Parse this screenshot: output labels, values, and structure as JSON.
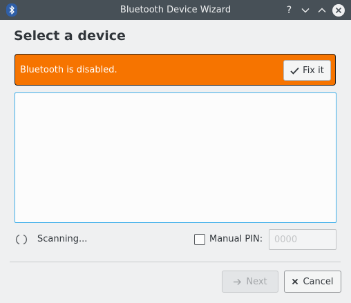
{
  "window": {
    "title": "Bluetooth Device Wizard",
    "icons": {
      "app": "bluetooth-icon",
      "help": "help-icon",
      "minimize": "chevron-down-icon",
      "maximize": "chevron-up-icon",
      "close": "close-icon"
    }
  },
  "page": {
    "heading": "Select a device"
  },
  "banner": {
    "message": "Bluetooth is disabled.",
    "action_label": "Fix it",
    "action_icon": "check-icon",
    "color": "#f67400"
  },
  "device_list": {
    "items": []
  },
  "status": {
    "scanning_text": "Scanning...",
    "spinner_icon": "spinner-icon"
  },
  "manual_pin": {
    "label": "Manual PIN:",
    "checked": false,
    "placeholder": "0000"
  },
  "footer": {
    "next_label": "Next",
    "next_icon": "arrow-right-icon",
    "next_enabled": false,
    "cancel_label": "Cancel",
    "cancel_icon": "close-icon"
  },
  "colors": {
    "titlebar": "#475057",
    "accent": "#3daee9",
    "background": "#eff0f1"
  }
}
